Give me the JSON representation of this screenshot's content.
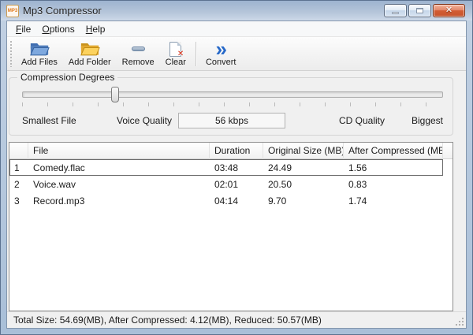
{
  "window": {
    "title": "Mp3 Compressor",
    "app_icon_label": "MP3"
  },
  "menu_bar": {
    "items": [
      {
        "label": "File"
      },
      {
        "label": "Options"
      },
      {
        "label": "Help"
      }
    ]
  },
  "toolbar": {
    "buttons": [
      {
        "label": "Add Files",
        "icon": "add-files-folder-icon"
      },
      {
        "label": "Add Folder",
        "icon": "add-folder-icon"
      },
      {
        "label": "Remove",
        "icon": "remove-minus-icon"
      },
      {
        "label": "Clear",
        "icon": "clear-document-icon"
      },
      {
        "label": "Convert",
        "icon": "convert-chevrons-icon",
        "chevrons": "»"
      }
    ]
  },
  "compression": {
    "group_label": "Compression Degrees",
    "slider_percent": 22,
    "scale_labels": {
      "smallest": "Smallest File",
      "voice": "Voice Quality",
      "cd": "CD Quality",
      "biggest": "Biggest"
    },
    "current_value": "56 kbps"
  },
  "file_table": {
    "headers": {
      "index": "",
      "file": "File",
      "duration": "Duration",
      "original": "Original Size (MB)",
      "compressed": "After Compressed (MB)"
    },
    "rows": [
      {
        "index": "1",
        "file": "Comedy.flac",
        "duration": "03:48",
        "original": "24.49",
        "compressed": "1.56",
        "selected": true
      },
      {
        "index": "2",
        "file": "Voice.wav",
        "duration": "02:01",
        "original": "20.50",
        "compressed": "0.83",
        "selected": false
      },
      {
        "index": "3",
        "file": "Record.mp3",
        "duration": "04:14",
        "original": "9.70",
        "compressed": "1.74",
        "selected": false
      }
    ]
  },
  "status_bar": {
    "text": "Total Size: 54.69(MB), After Compressed: 4.12(MB), Reduced: 50.57(MB)"
  },
  "colors": {
    "frame_blue": "#a9bfd8",
    "close_button_red": "#c8552d",
    "convert_blue": "#2668c8",
    "add_files_folder_blue": "#4f7cba",
    "add_folder_yellow": "#f7c families"
  }
}
